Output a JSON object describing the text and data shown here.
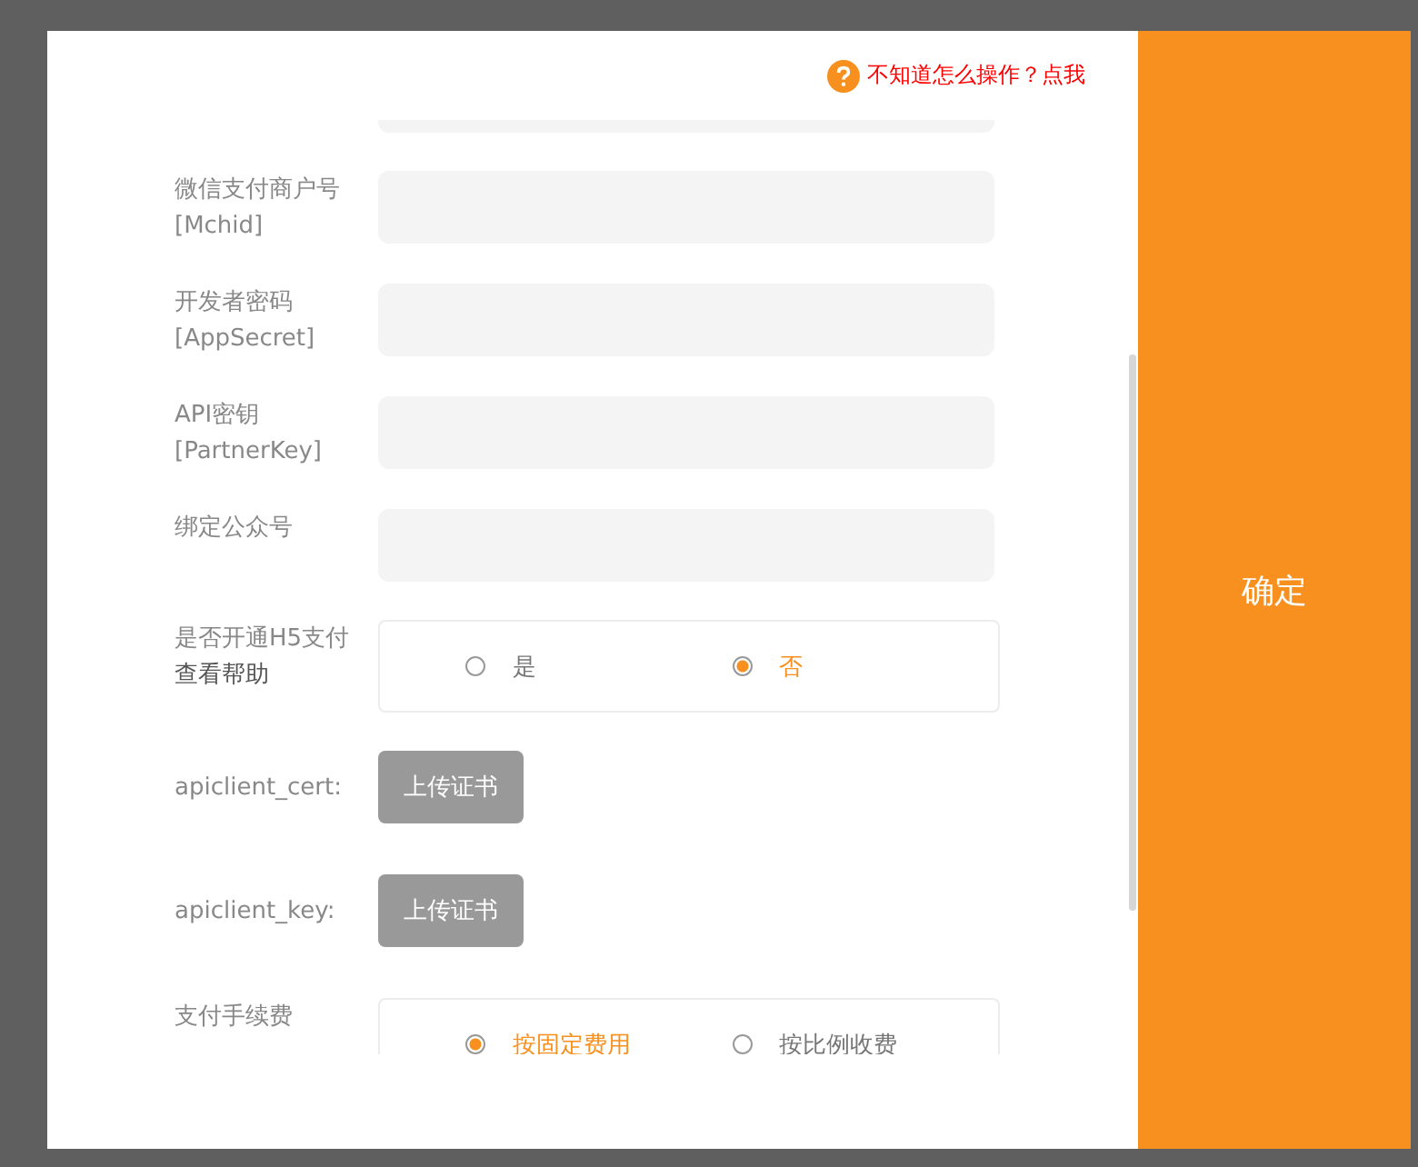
{
  "help_link": "不知道怎么操作？点我",
  "rows": [
    {
      "kind": "input"
    },
    {
      "kind": "input",
      "label": "微信支付商户号",
      "sublabel": "[Mchid]"
    },
    {
      "kind": "input",
      "label": "开发者密码",
      "sublabel": "[AppSecret]"
    },
    {
      "kind": "input",
      "label": "API密钥",
      "sublabel": "[PartnerKey]"
    },
    {
      "kind": "input",
      "label": "绑定公众号"
    },
    {
      "kind": "radio",
      "label": "是否开通H5支付",
      "link": "查看帮助",
      "options": [
        {
          "label": "是",
          "selected": false
        },
        {
          "label": "否",
          "selected": true
        }
      ]
    },
    {
      "kind": "upload",
      "label": "apiclient_cert:",
      "button": "上传证书"
    },
    {
      "kind": "upload",
      "label": "apiclient_key:",
      "button": "上传证书"
    },
    {
      "kind": "radio",
      "label": "支付手续费",
      "options": [
        {
          "label": "按固定费用",
          "selected": true
        },
        {
          "label": "按比例收费",
          "selected": false
        }
      ]
    }
  ],
  "confirm_button": "确定"
}
